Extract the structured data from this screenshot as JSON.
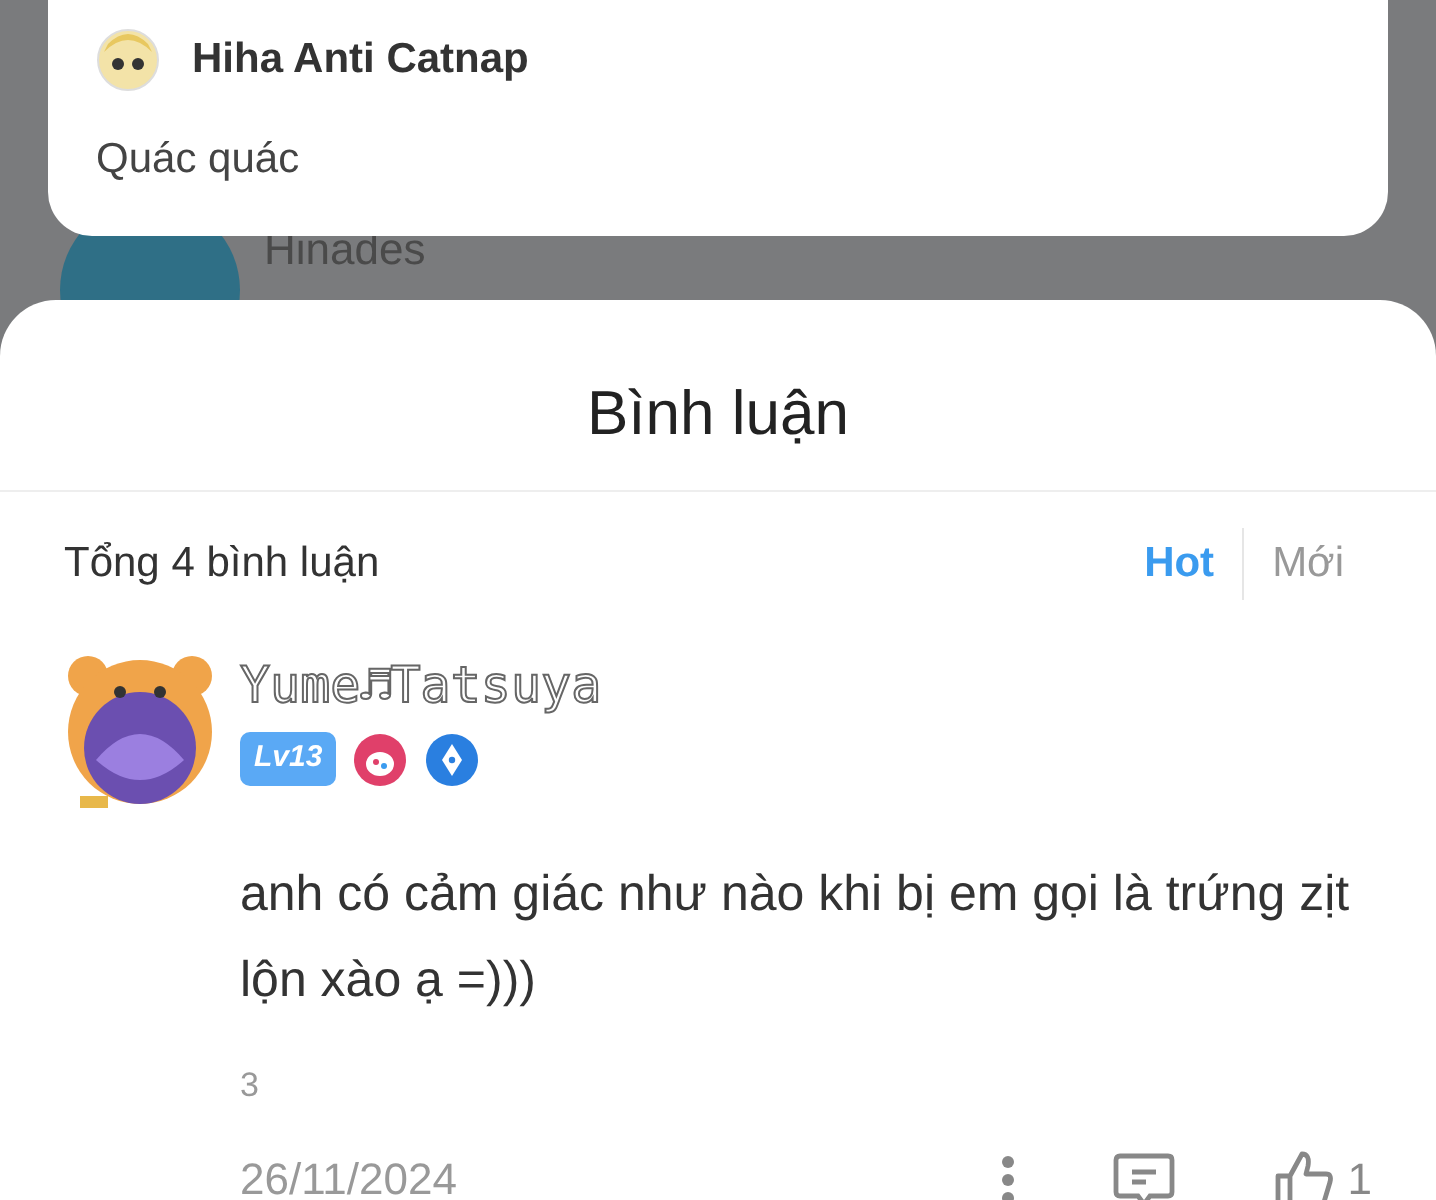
{
  "background_post": {
    "author": "Hinades"
  },
  "quoted_comment": {
    "author": "Hiha Anti Catnap",
    "text": "Quác quác"
  },
  "comments_sheet": {
    "title": "Bình luận",
    "total": "Tổng 4 bình luận",
    "sort_tabs": [
      {
        "label": "Hot",
        "selected": true
      },
      {
        "label": "Mới",
        "selected": false
      }
    ],
    "comments": [
      {
        "author": "Yume♬Tatsuya",
        "level": "Lv13",
        "text": "anh có cảm giác như nào khi bị em gọi là trứng zịt lộn xào ạ =)))",
        "reply_count": "3",
        "date": "26/11/2024",
        "likes": "1"
      }
    ]
  }
}
